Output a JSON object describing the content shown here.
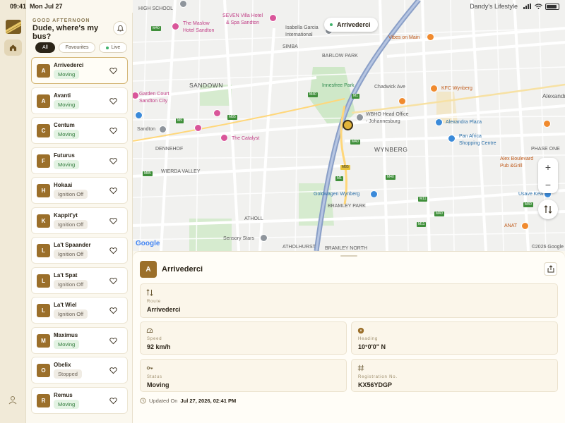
{
  "status_bar": {
    "time": "09:41",
    "date": "Mon Jul 27",
    "user": "Dandy's Lifestyle"
  },
  "sidebar": {
    "greeting": "GOOD AFTERNOON",
    "title": "Dude, where's my bus?",
    "filters": [
      {
        "label": "All",
        "active": true
      },
      {
        "label": "Favourites",
        "active": false
      },
      {
        "label": "Live",
        "active": false
      }
    ],
    "vehicles": [
      {
        "initial": "A",
        "name": "Arrivederci",
        "status": "Moving",
        "selected": true
      },
      {
        "initial": "A",
        "name": "Avanti",
        "status": "Moving"
      },
      {
        "initial": "C",
        "name": "Centum",
        "status": "Moving"
      },
      {
        "initial": "F",
        "name": "Futurus",
        "status": "Moving"
      },
      {
        "initial": "H",
        "name": "Hokaai",
        "status": "Ignition Off"
      },
      {
        "initial": "K",
        "name": "Kappit'yt",
        "status": "Ignition Off"
      },
      {
        "initial": "L",
        "name": "La't Spaander",
        "status": "Ignition Off"
      },
      {
        "initial": "L",
        "name": "La't Spat",
        "status": "Ignition Off"
      },
      {
        "initial": "L",
        "name": "La't Wiel",
        "status": "Ignition Off"
      },
      {
        "initial": "M",
        "name": "Maximus",
        "status": "Moving"
      },
      {
        "initial": "O",
        "name": "Obelix",
        "status": "Stopped"
      },
      {
        "initial": "R",
        "name": "Remus",
        "status": "Moving"
      }
    ]
  },
  "map": {
    "callout": "Arrivederci",
    "attribution_logo": "Google",
    "copyright": "©2026 Google",
    "labels": {
      "high_school": "HIGH SCHOOL",
      "maslow": "The Maslow\nHotel Sandton",
      "seven_villa": "SEVEN Villa Hotel\n& Spa Sandton",
      "isabella": "Isabella Garcia\nInternational",
      "simba": "SIMBA",
      "vibes": "Vibes on Main",
      "barlow_park": "BARLOW PARK",
      "sandown": "SANDOWN",
      "innesfree": "Innesfree Park",
      "chadwick": "Chadwick Ave",
      "kfc": "KFC Wynberg",
      "garden_court": "Garden Court\nSandton City",
      "wbho": "WBHO Head Office\n- Johannesburg",
      "alexandra_plaza": "Alexandra Plaza",
      "pan_africa": "Pan Africa\nShopping Centre",
      "sandton": "Sandton",
      "catalyst": "The Catalyst",
      "wynberg": "WYNBERG",
      "dennehof": "DENNEHOF",
      "wierda_valley": "WIERDA VALLEY",
      "phase_one": "PHASE ONE",
      "alex_boulevard": "Alex Boulevard\nPub &Grill",
      "goldwagen": "Goldwagen Wynberg",
      "bramley_park": "BRAMLEY PARK",
      "usave": "Usave Kew",
      "anat": "ANAT",
      "sensory_stars": "Sensory Stars",
      "atholl": "ATHOLL",
      "atholhurst": "ATHOLHURST",
      "bramley_north": "BRAMLEY NORTH",
      "alexandra": "Alexandra"
    },
    "shields": [
      "M40",
      "M40",
      "M1",
      "M1",
      "M9",
      "M85",
      "M85",
      "M40",
      "M40",
      "M11",
      "M40",
      "M40",
      "M85",
      "M11"
    ]
  },
  "detail": {
    "initial": "A",
    "title": "Arrivederci",
    "route_label": "Route",
    "route_value": "Arrivederci",
    "speed_label": "Speed",
    "speed_value": "92 km/h",
    "heading_label": "Heading",
    "heading_value": "10°0'0\" N",
    "status_label": "Status",
    "status_value": "Moving",
    "reg_label": "Registration No.",
    "reg_value": "KX56YDGP",
    "updated_label": "Updated On",
    "updated_value": "Jul 27, 2026, 02:41 PM"
  },
  "colors": {
    "accent": "#9b6f2a",
    "moving_bg": "#e3f3e3",
    "moving_text": "#2f7a3a",
    "off_bg": "#f0ece4",
    "highway": "#8a9fc7"
  }
}
